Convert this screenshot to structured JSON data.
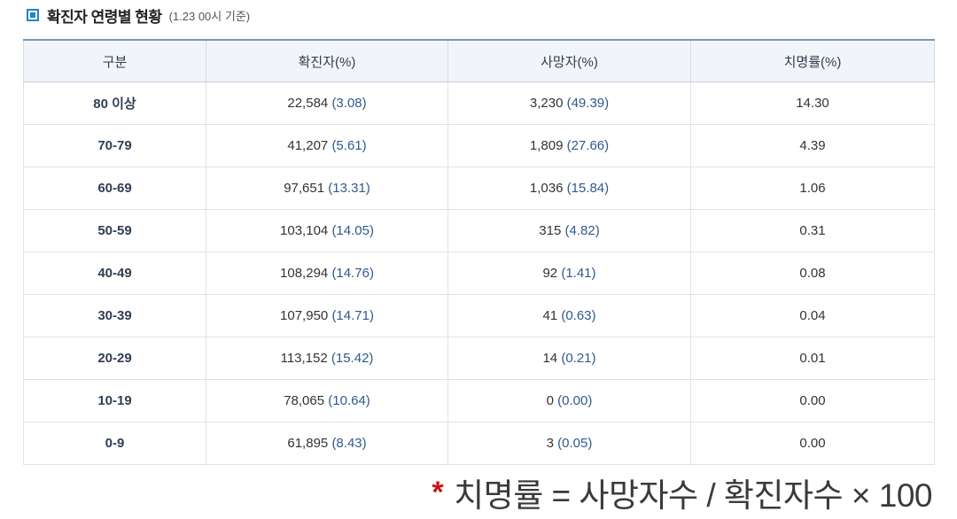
{
  "header": {
    "title": "확진자 연령별 현황",
    "subtitle": "(1.23 00시 기준)",
    "icon": "square-bullet-icon",
    "accent_color": "#1f86c6"
  },
  "table": {
    "columns": [
      "구분",
      "확진자(%)",
      "사망자(%)",
      "치명률(%)"
    ],
    "rows": [
      {
        "age": "80 이상",
        "confirmed": "22,584",
        "confirmed_pct": "(3.08)",
        "deaths": "3,230",
        "deaths_pct": "(49.39)",
        "fatality": "14.30"
      },
      {
        "age": "70-79",
        "confirmed": "41,207",
        "confirmed_pct": "(5.61)",
        "deaths": "1,809",
        "deaths_pct": "(27.66)",
        "fatality": "4.39"
      },
      {
        "age": "60-69",
        "confirmed": "97,651",
        "confirmed_pct": "(13.31)",
        "deaths": "1,036",
        "deaths_pct": "(15.84)",
        "fatality": "1.06"
      },
      {
        "age": "50-59",
        "confirmed": "103,104",
        "confirmed_pct": "(14.05)",
        "deaths": "315",
        "deaths_pct": "(4.82)",
        "fatality": "0.31"
      },
      {
        "age": "40-49",
        "confirmed": "108,294",
        "confirmed_pct": "(14.76)",
        "deaths": "92",
        "deaths_pct": "(1.41)",
        "fatality": "0.08"
      },
      {
        "age": "30-39",
        "confirmed": "107,950",
        "confirmed_pct": "(14.71)",
        "deaths": "41",
        "deaths_pct": "(0.63)",
        "fatality": "0.04"
      },
      {
        "age": "20-29",
        "confirmed": "113,152",
        "confirmed_pct": "(15.42)",
        "deaths": "14",
        "deaths_pct": "(0.21)",
        "fatality": "0.01"
      },
      {
        "age": "10-19",
        "confirmed": "78,065",
        "confirmed_pct": "(10.64)",
        "deaths": "0",
        "deaths_pct": "(0.00)",
        "fatality": "0.00"
      },
      {
        "age": "0-9",
        "confirmed": "61,895",
        "confirmed_pct": "(8.43)",
        "deaths": "3",
        "deaths_pct": "(0.05)",
        "fatality": "0.00"
      }
    ]
  },
  "footnote": {
    "marker": "*",
    "text": "치명률 = 사망자수 / 확진자수 × 100"
  }
}
